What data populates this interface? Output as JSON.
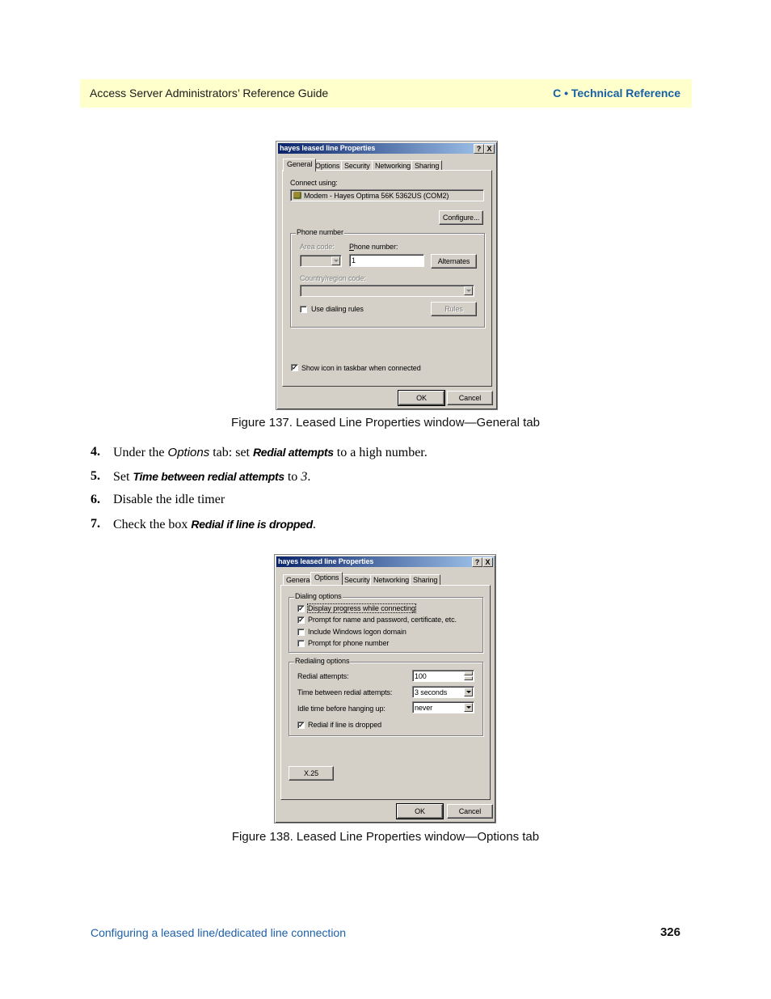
{
  "header": {
    "left": "Access Server Administrators’ Reference Guide",
    "right": "C • Technical Reference",
    "band_color": "#ffffcc",
    "accent_color": "#1660a8"
  },
  "figure137": {
    "dialog": {
      "title": "hayes leased line Properties",
      "help_button": "?",
      "close_button": "X",
      "tabs": [
        "General",
        "Options",
        "Security",
        "Networking",
        "Sharing"
      ],
      "active_tab": "General",
      "connect_using_label": "Connect using:",
      "connect_using_value": "Modem - Hayes Optima 56K 5362US (COM2)",
      "configure_button": "Configure...",
      "phone_group_label": "Phone number",
      "area_code_label": "Area code:",
      "area_code_value": "",
      "phone_number_label": "Phone number:",
      "phone_number_value": "1",
      "alternates_button": "Alternates",
      "country_label": "Country/region code:",
      "country_value": "",
      "use_dialing_rules_label": "Use dialing rules",
      "use_dialing_rules_checked": false,
      "rules_button": "Rules",
      "show_icon_label": "Show icon in taskbar when connected",
      "show_icon_checked": true,
      "ok_button": "OK",
      "cancel_button": "Cancel"
    },
    "caption": "Figure 137. Leased Line Properties window—General tab"
  },
  "steps": [
    {
      "num": "4.",
      "pre": "Under the ",
      "em": "Options",
      "mid": " tab: set ",
      "bold": "Redial attempts",
      "post": " to a high number."
    },
    {
      "num": "5.",
      "pre": "Set ",
      "bold": "Time between redial attempts",
      "mid": " to ",
      "em": "3",
      "post": "."
    },
    {
      "num": "6.",
      "text": "Disable the idle timer"
    },
    {
      "num": "7.",
      "pre": "Check the box ",
      "bold": "Redial if line is dropped",
      "post": "."
    }
  ],
  "figure138": {
    "dialog": {
      "title": "hayes leased line Properties",
      "help_button": "?",
      "close_button": "X",
      "tabs": [
        "General",
        "Options",
        "Security",
        "Networking",
        "Sharing"
      ],
      "active_tab": "Options",
      "dialing_group_label": "Dialing options",
      "dialing_options": [
        {
          "label": "Display progress while connecting",
          "checked": true
        },
        {
          "label": "Prompt for name and password, certificate, etc.",
          "checked": true
        },
        {
          "label": "Include Windows logon domain",
          "checked": false
        },
        {
          "label": "Prompt for phone number",
          "checked": false
        }
      ],
      "redial_group_label": "Redialing options",
      "redial_attempts_label": "Redial attempts:",
      "redial_attempts_value": "100",
      "time_between_label": "Time between redial attempts:",
      "time_between_value": "3 seconds",
      "idle_time_label": "Idle time before hanging up:",
      "idle_time_value": "never",
      "redial_if_dropped_label": "Redial if line is dropped",
      "redial_if_dropped_checked": true,
      "x25_button": "X.25",
      "ok_button": "OK",
      "cancel_button": "Cancel"
    },
    "caption": "Figure 138. Leased Line Properties window—Options tab"
  },
  "footer": {
    "left": "Configuring a leased line/dedicated line connection",
    "page_number": "326"
  }
}
